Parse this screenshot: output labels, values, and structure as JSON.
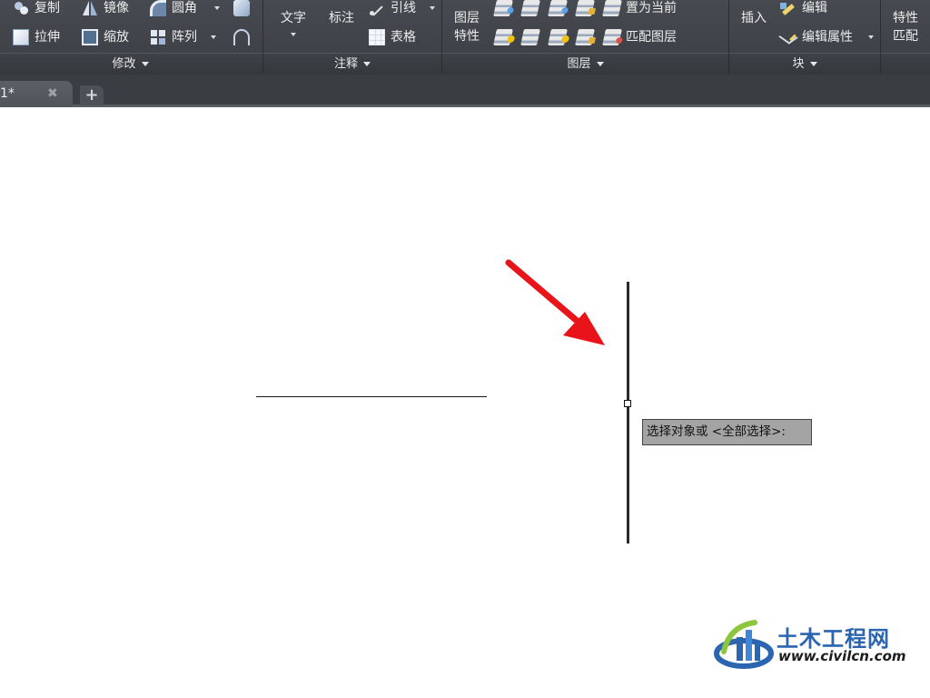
{
  "ribbon": {
    "modify": {
      "title": "修改",
      "copy": "复制",
      "mirror": "镜像",
      "fillet": "圆角",
      "stretch": "拉伸",
      "scale": "缩放",
      "array": "阵列"
    },
    "annotation": {
      "title": "注释",
      "text": "文字",
      "dimension": "标注",
      "leader": "引线",
      "table": "表格"
    },
    "layers": {
      "title": "图层",
      "layer_properties_line1": "图层",
      "layer_properties_line2": "特性",
      "set_current": "置为当前",
      "match_layer": "匹配图层"
    },
    "block": {
      "title": "块",
      "insert": "插入",
      "edit": "编辑",
      "edit_attributes": "编辑属性"
    },
    "properties": {
      "match_line1": "特性",
      "match_line2": "匹配"
    }
  },
  "tabs": {
    "drawing_label": "1*",
    "close_glyph": "✖",
    "add_glyph": "+"
  },
  "canvas": {
    "command_prompt": "选择对象或 <全部选择>:"
  },
  "watermark": {
    "name": "土木工程网",
    "url": "www.civilcn.com"
  },
  "colors": {
    "ribbon_bg": "#404348",
    "arrow": "#e8141a",
    "prompt_bg": "#a4a4a4",
    "watermark_blue": "#2b65b0"
  }
}
